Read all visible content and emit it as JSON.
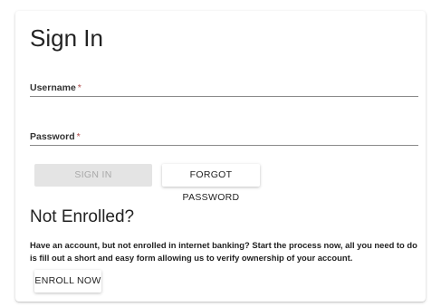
{
  "signin": {
    "title": "Sign In",
    "username_label": "Username",
    "password_label": "Password",
    "required_mark": "*",
    "signin_button": "SIGN IN",
    "forgot_button": "FORGOT PASSWORD"
  },
  "enroll": {
    "title": "Not Enrolled?",
    "description": "Have an account, but not enrolled in internet banking? Start the process now, all you need to do is fill out a short and easy form allowing us to verify ownership of your account.",
    "enroll_button": "ENROLL NOW"
  }
}
